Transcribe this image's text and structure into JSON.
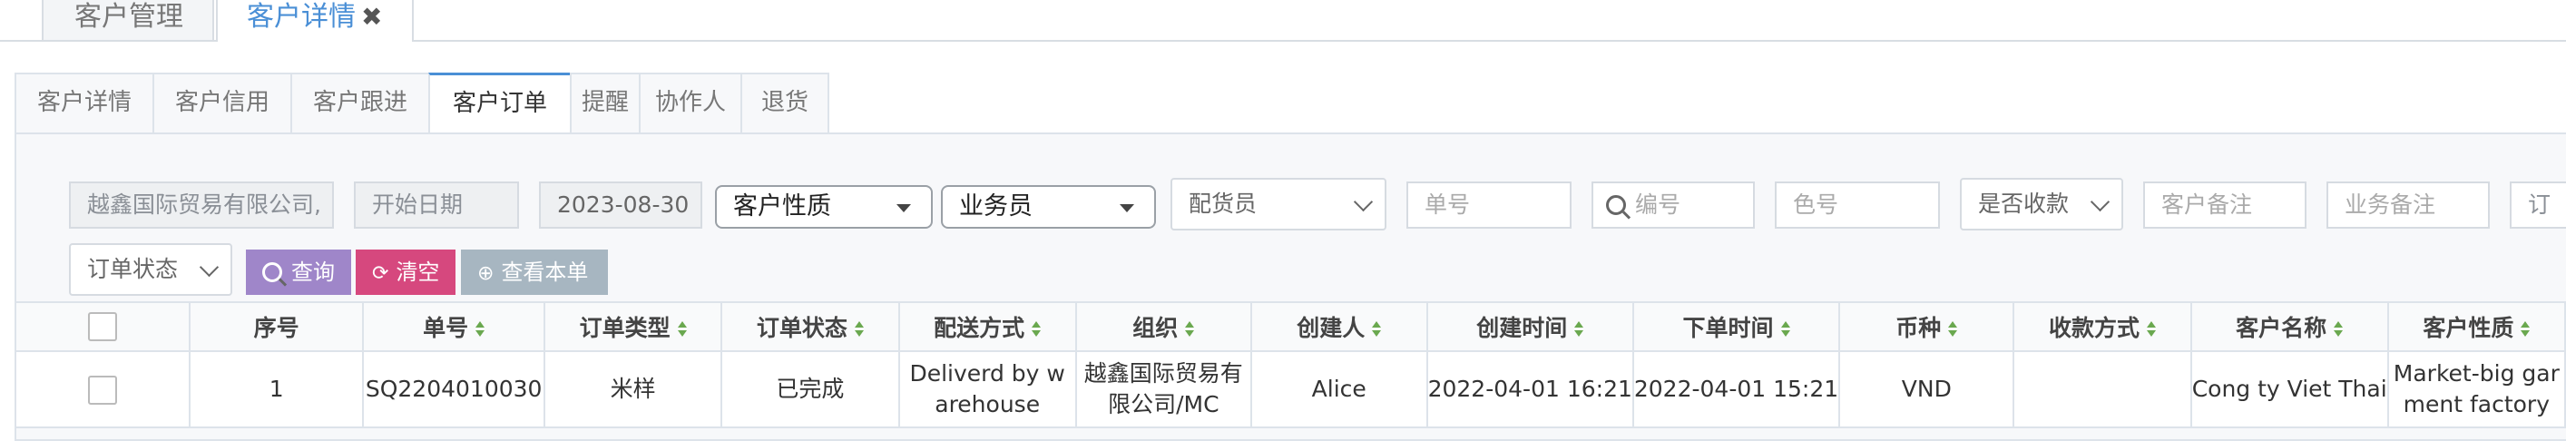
{
  "page_tabs": [
    {
      "label": "客户管理"
    },
    {
      "label": "客户详情",
      "close": "✖"
    }
  ],
  "sub_tabs": [
    "客户详情",
    "客户信用",
    "客户跟进",
    "客户订单",
    "提醒",
    "协作人",
    "退货"
  ],
  "active_sub_tab": "客户订单",
  "filters": {
    "customer": "越鑫国际贸易有限公司,",
    "start_date_placeholder": "开始日期",
    "end_date": "2023-08-30",
    "customer_type": "客户性质",
    "salesperson": "业务员",
    "distributor": "配货员",
    "order_no_placeholder": "单号",
    "code_placeholder": "编号",
    "color_no_placeholder": "色号",
    "paid": "是否收款",
    "customer_note_placeholder": "客户备注",
    "business_note_placeholder": "业务备注",
    "order_status": "订单状态"
  },
  "buttons": {
    "query": "查询",
    "clear": "清空",
    "view": "查看本单"
  },
  "table": {
    "columns": [
      "序号",
      "单号",
      "订单类型",
      "订单状态",
      "配送方式",
      "组织",
      "创建人",
      "创建时间",
      "下单时间",
      "币种",
      "收款方式",
      "客户名称",
      "客户性质"
    ],
    "rows": [
      {
        "seq": "1",
        "order_no": "SQ2204010030",
        "order_type": "米样",
        "status": "已完成",
        "delivery": "Deliverd by warehouse",
        "org": "越鑫国际贸易有限公司/MC",
        "creator": "Alice",
        "created": "2022-04-01 16:21",
        "ordered": "2022-04-01 15:21",
        "currency": "VND",
        "payment": "",
        "customer_name": "Cong ty Viet Thai",
        "customer_type": "Market-big garment factory"
      }
    ]
  }
}
